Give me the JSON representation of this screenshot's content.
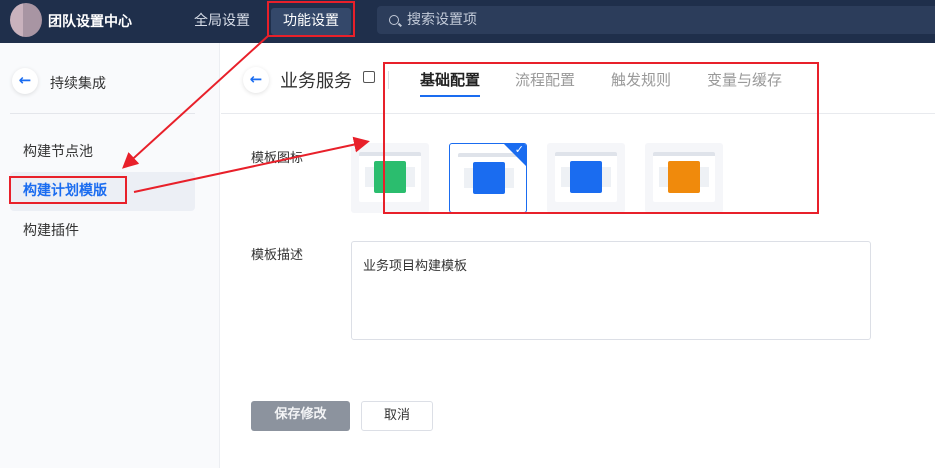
{
  "header": {
    "app_title": "团队设置中心",
    "nav": [
      {
        "label": "全局设置"
      },
      {
        "label": "功能设置",
        "active": true
      }
    ],
    "search_placeholder": "搜索设置项"
  },
  "sidebar": {
    "title": "持续集成",
    "items": [
      {
        "label": "构建节点池"
      },
      {
        "label": "构建计划模版",
        "active": true
      },
      {
        "label": "构建插件"
      }
    ]
  },
  "main": {
    "title": "业务服务",
    "tabs": [
      {
        "label": "基础配置",
        "active": true
      },
      {
        "label": "流程配置"
      },
      {
        "label": "触发规则"
      },
      {
        "label": "变量与缓存"
      }
    ],
    "icon_label": "模板图标",
    "icons": [
      {
        "name": "clover-icon",
        "color": "#2bbd6e"
      },
      {
        "name": "user-icon",
        "color": "#1a6cf0",
        "selected": true
      },
      {
        "name": "layers-icon",
        "color": "#1a6cf0"
      },
      {
        "name": "document-icon",
        "color": "#f08a0c"
      }
    ],
    "desc_label": "模板描述",
    "desc_value": "业务项目构建模板",
    "save_label": "保存修改",
    "cancel_label": "取消"
  },
  "colors": {
    "accent": "#1a6cf0",
    "header_bg": "#1f2f4b",
    "annotation": "#e8202a"
  }
}
